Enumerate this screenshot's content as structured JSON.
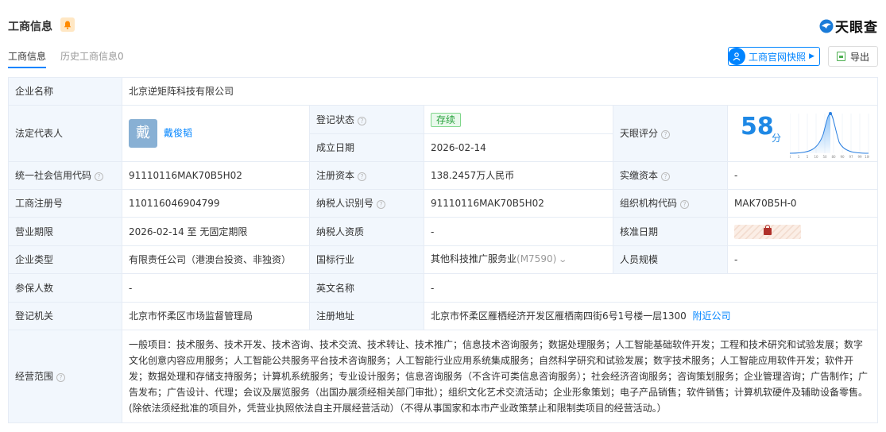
{
  "header": {
    "title": "工商信息",
    "logo_text": "天眼查"
  },
  "tabs": [
    {
      "label": "工商信息",
      "active": true
    },
    {
      "label": "历史工商信息0",
      "active": false
    }
  ],
  "actions": {
    "snapshot_label": "工商官网快照",
    "export_label": "导出"
  },
  "rows": {
    "company_name": {
      "label": "企业名称",
      "value": "北京逆矩阵科技有限公司"
    },
    "legal_rep": {
      "label": "法定代表人",
      "avatar_char": "戴",
      "name": "戴俊韬"
    },
    "reg_status": {
      "label": "登记状态",
      "value": "存续"
    },
    "found_date": {
      "label": "成立日期",
      "value": "2026-02-14"
    },
    "score": {
      "label": "天眼评分",
      "value": "58",
      "unit": "分",
      "axis": [
        "0",
        "1",
        "5",
        "10",
        "50",
        "80",
        "90",
        "97",
        "99",
        "100"
      ]
    },
    "credit_code": {
      "label": "统一社会信用代码",
      "value": "91110116MAK70B5H02"
    },
    "reg_capital": {
      "label": "注册资本",
      "value": "138.2457万人民币"
    },
    "paid_capital": {
      "label": "实缴资本",
      "value": "-"
    },
    "reg_no": {
      "label": "工商注册号",
      "value": "110116046904799"
    },
    "taxpayer_id": {
      "label": "纳税人识别号",
      "value": "91110116MAK70B5H02"
    },
    "org_code": {
      "label": "组织机构代码",
      "value": "MAK70B5H-0"
    },
    "term": {
      "label": "营业期限",
      "value": "2026-02-14 至 无固定期限"
    },
    "taxpayer_qual": {
      "label": "纳税人资质",
      "value": "-"
    },
    "approve_date": {
      "label": "核准日期"
    },
    "company_type": {
      "label": "企业类型",
      "value": "有限责任公司（港澳台投资、非独资）"
    },
    "industry": {
      "label": "国标行业",
      "value": "其他科技推广服务业",
      "code": "(M7590)"
    },
    "staff_size": {
      "label": "人员规模",
      "value": "-"
    },
    "insured": {
      "label": "参保人数",
      "value": "-"
    },
    "english_name": {
      "label": "英文名称",
      "value": "-"
    },
    "authority": {
      "label": "登记机关",
      "value": "北京市怀柔区市场监督管理局"
    },
    "address": {
      "label": "注册地址",
      "value": "北京市怀柔区雁栖经济开发区雁栖南四街6号1号楼一层1300",
      "nearby": "附近公司"
    },
    "scope": {
      "label": "经营范围",
      "value": "一般项目：技术服务、技术开发、技术咨询、技术交流、技术转让、技术推广；信息技术咨询服务；数据处理服务；人工智能基础软件开发；工程和技术研究和试验发展；数字文化创意内容应用服务；人工智能公共服务平台技术咨询服务；人工智能行业应用系统集成服务；自然科学研究和试验发展；数字技术服务；人工智能应用软件开发；软件开发；数据处理和存储支持服务；计算机系统服务；专业设计服务；信息咨询服务（不含许可类信息咨询服务）；社会经济咨询服务；咨询策划服务；企业管理咨询；广告制作；广告发布；广告设计、代理；会议及展览服务（出国办展须经相关部门审批）；组织文化艺术交流活动；企业形象策划；电子产品销售；软件销售；计算机软硬件及辅助设备零售。(除依法须经批准的项目外，凭营业执照依法自主开展经营活动）（不得从事国家和本市产业政策禁止和限制类项目的经营活动。）"
    }
  },
  "colors": {
    "accent": "#0084ff",
    "label_bg": "#f2f7fd",
    "status_green": "#27a03b"
  }
}
